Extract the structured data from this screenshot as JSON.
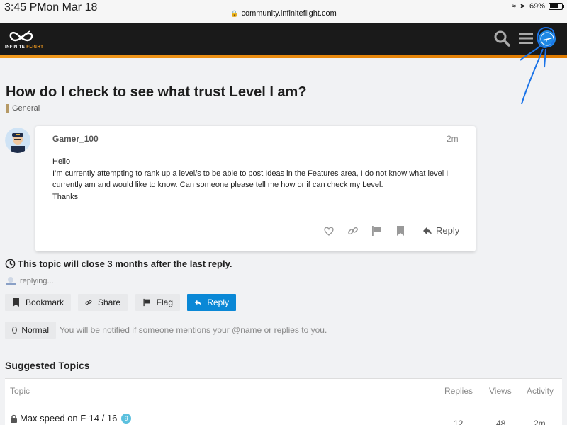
{
  "status_bar": {
    "time": "3:45 PM",
    "date": "Mon Mar 18",
    "url": "community.infiniteflight.com",
    "battery": "69%"
  },
  "header": {
    "logo_text_main": "INFINITE ",
    "logo_text_accent": "FLIGHT"
  },
  "topic": {
    "title": "How do I check to see what trust Level I am?",
    "category": "General"
  },
  "post": {
    "username": "Gamer_100",
    "time": "2m",
    "body_lines": [
      "Hello",
      "I’m currently attempting to rank up a level/s to be able to post Ideas in the Features area, I do not know what level I currently am and would like to know. Can someone please tell me how or if can check my Level.",
      "Thanks"
    ],
    "reply_label": "Reply"
  },
  "close_notice": "This topic will close 3 months after the last reply.",
  "replying_text": "replying...",
  "footer_buttons": {
    "bookmark": "Bookmark",
    "share": "Share",
    "flag": "Flag",
    "reply": "Reply"
  },
  "notifications": {
    "level": "Normal",
    "description": "You will be notified if someone mentions your @name or replies to you."
  },
  "suggested": {
    "title": "Suggested Topics",
    "columns": [
      "Topic",
      "Replies",
      "Views",
      "Activity"
    ],
    "rows": [
      {
        "title": "Max speed on F-14 / 16",
        "badge": "9",
        "replies": "12",
        "views": "48",
        "activity": "2m"
      }
    ]
  },
  "colors": {
    "header_bg": "#1a1a1a",
    "accent_orange": "#f29b1f",
    "reply_blue": "#0a88d6",
    "category_tan": "#b69a66",
    "annotation_blue": "#1a73e8"
  }
}
